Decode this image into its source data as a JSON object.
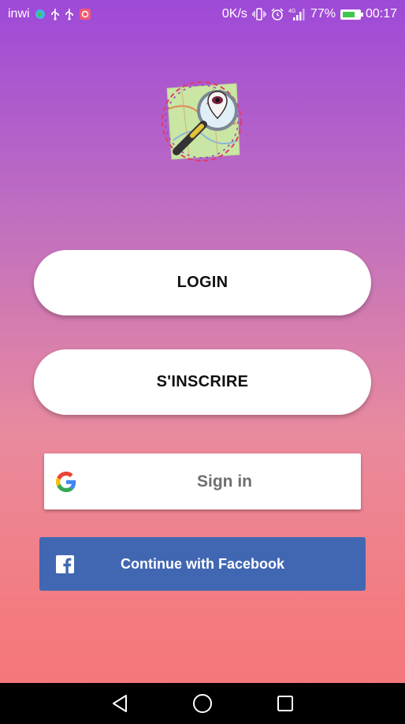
{
  "status_bar": {
    "carrier": "inwi",
    "net_speed": "0K/s",
    "network_type": "4G",
    "battery": "77%",
    "time": "00:17",
    "icons": [
      "globe-icon",
      "usb-icon",
      "usb-icon",
      "message-icon",
      "vibrate-icon",
      "alarm-icon",
      "signal-icon",
      "battery-icon"
    ]
  },
  "logo": {
    "name": "map-magnifier-logo"
  },
  "buttons": {
    "login": "LOGIN",
    "register": "S'INSCRIRE",
    "google": "Sign in",
    "facebook": "Continue with Facebook"
  },
  "colors": {
    "gradient_top": "#9e49d8",
    "gradient_bottom": "#f47478",
    "facebook": "#4267b2",
    "google_text": "#6f6f6f"
  },
  "nav": {
    "icons": [
      "back-icon",
      "home-icon",
      "recents-icon"
    ]
  }
}
